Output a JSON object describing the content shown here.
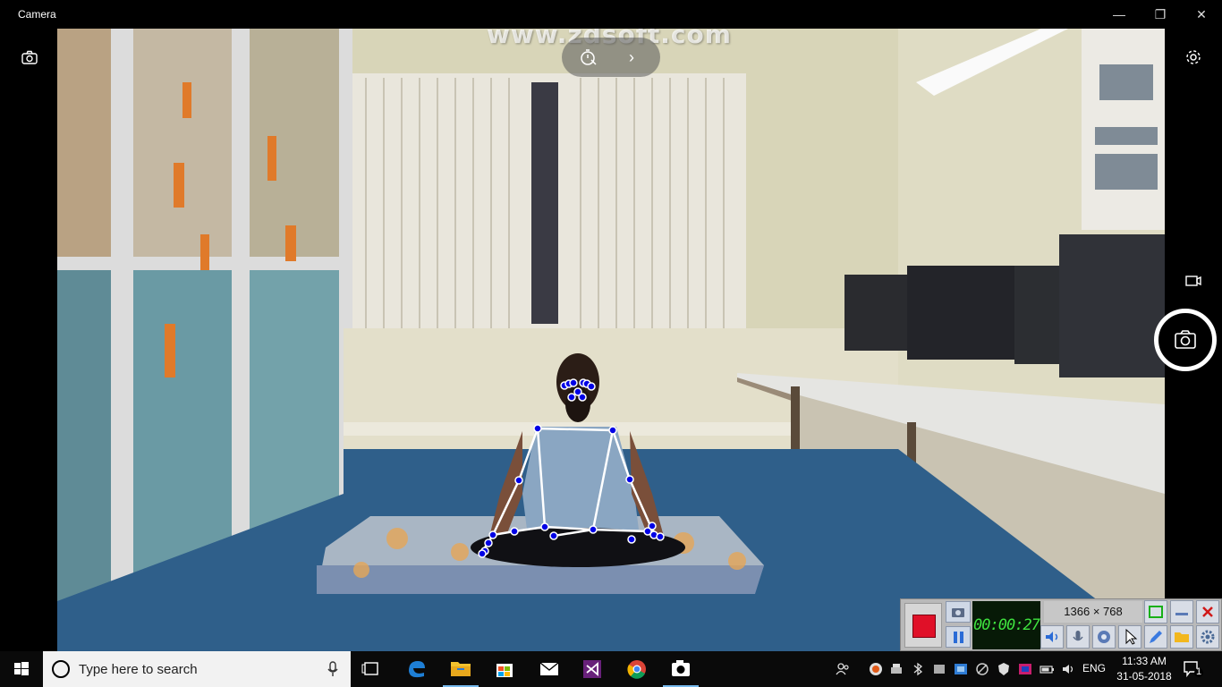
{
  "window": {
    "title": "Camera",
    "minimize_glyph": "—",
    "maximize_glyph": "❐",
    "close_glyph": "✕"
  },
  "camera": {
    "watermark": "www.zdsoft.com",
    "timer_chevron": "›",
    "icons": {
      "left_top": "camera-switch-icon",
      "settings": "gear-icon",
      "video_mode": "video-camera-icon",
      "shutter": "photo-camera-icon",
      "timer": "timer-icon"
    }
  },
  "recorder": {
    "timer": "00:00:27",
    "dimensions": "1366 × 768",
    "colors": {
      "record": "#e01028",
      "lcd_text": "#3fe23f",
      "lcd_bg": "#071a07"
    }
  },
  "taskbar": {
    "search_placeholder": "Type here to search",
    "language": "ENG",
    "time": "11:33 AM",
    "date": "31-05-2018",
    "notification_count": "1",
    "apps": [
      "task-view-icon",
      "edge-icon",
      "file-explorer-icon",
      "store-icon",
      "mail-icon",
      "visual-studio-icon",
      "chrome-icon",
      "camera-app-icon"
    ]
  }
}
